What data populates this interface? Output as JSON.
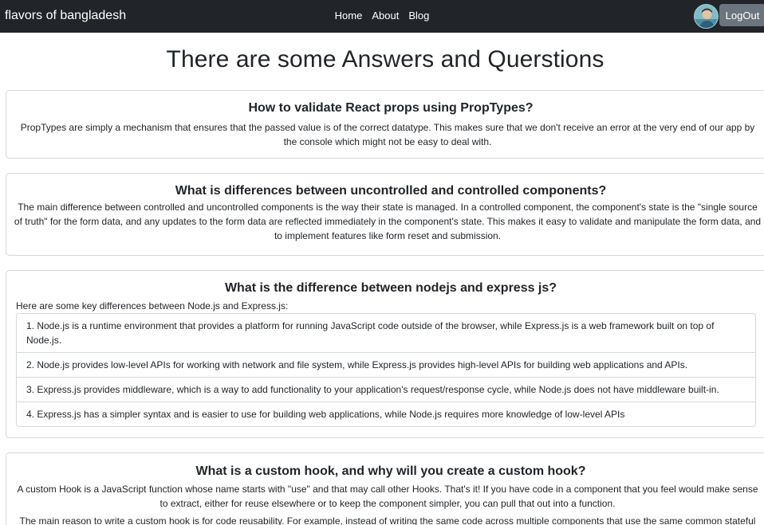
{
  "navbar": {
    "brand": "flavors of bangladesh",
    "links": [
      "Home",
      "About",
      "Blog"
    ],
    "logout_label": "LogOut"
  },
  "page_title": "There are some Answers and Querstions",
  "qa": [
    {
      "question": "How to validate React props using PropTypes?",
      "answer": "PropTypes are simply a mechanism that ensures that the passed value is of the correct datatype. This makes sure that we don't receive an error at the very end of our app by the console which might not be easy to deal with."
    },
    {
      "question": "What is differences between uncontrolled and controlled components?",
      "answer": "The main difference between controlled and uncontrolled components is the way their state is managed. In a controlled component, the component's state is the \"single source of truth\" for the form data, and any updates to the form data are reflected immediately in the component's state. This makes it easy to validate and manipulate the form data, and to implement features like form reset and submission."
    },
    {
      "question": "What is the difference between nodejs and express js?",
      "intro": "Here are some key differences between Node.js and Express.js:",
      "items": [
        "1. Node.js is a runtime environment that provides a platform for running JavaScript code outside of the browser, while Express.js is a web framework built on top of Node.js.",
        "2. Node.js provides low-level APIs for working with network and file system, while Express.js provides high-level APIs for building web applications and APIs.",
        "3. Express.js provides middleware, which is a way to add functionality to your application's request/response cycle, while Node.js does not have middleware built-in.",
        "4. Express.js has a simpler syntax and is easier to use for building web applications, while Node.js requires more knowledge of low-level APIs"
      ]
    },
    {
      "question": "What is a custom hook, and why will you create a custom hook?",
      "answer": "A custom Hook is a JavaScript function whose name starts with \"use\" and that may call other Hooks. That's it! If you have code in a component that you feel would make sense to extract, either for reuse elsewhere or to keep the component simpler, you can pull that out into a function.",
      "answer_2": "The main reason to write a custom hook is for code reusability. For example, instead of writing the same code across multiple components that use the same common stateful"
    }
  ]
}
